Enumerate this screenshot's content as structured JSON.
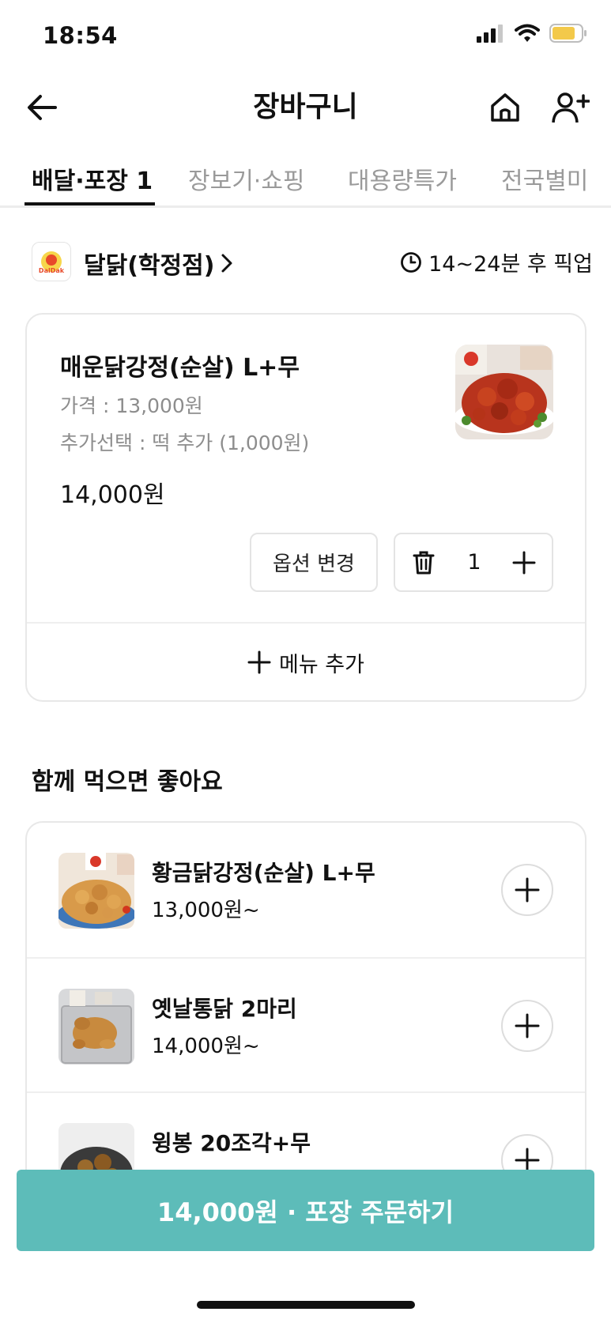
{
  "status": {
    "time": "18:54",
    "battery_color": "#f3c94a"
  },
  "header": {
    "title": "장바구니"
  },
  "tabs": [
    {
      "label": "배달·포장 1",
      "active": true
    },
    {
      "label": "장보기·쇼핑"
    },
    {
      "label": "대용량특가"
    },
    {
      "label": "전국별미"
    }
  ],
  "store": {
    "name": "달닭(학정점)",
    "logo_text": "DalDak",
    "pickup_time": "14~24분 후 픽업"
  },
  "cart_item": {
    "name": "매운닭강정(순살) L+무",
    "price_line": "가격 : 13,000원",
    "option_line": "추가선택 : 떡 추가 (1,000원)",
    "total": "14,000원",
    "option_button": "옵션 변경",
    "quantity": "1",
    "add_menu": "메뉴 추가"
  },
  "recommend": {
    "title": "함께 먹으면 좋아요",
    "items": [
      {
        "name": "황금닭강정(순살) L+무",
        "price": "13,000원~"
      },
      {
        "name": "옛날통닭 2마리",
        "price": "14,000원~"
      },
      {
        "name": "윙봉 20조각+무",
        "price": ""
      }
    ]
  },
  "order_button": {
    "label": "14,000원 · 포장 주문하기",
    "color": "#5dbcb9"
  }
}
